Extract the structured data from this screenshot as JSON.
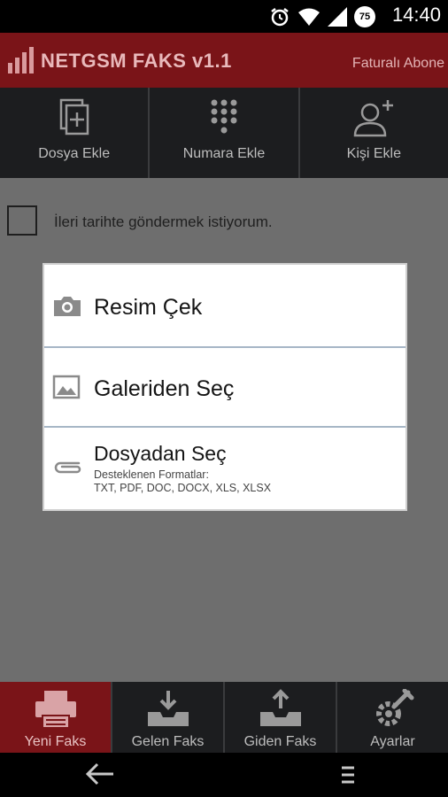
{
  "status_bar": {
    "time": "14:40",
    "battery": "75"
  },
  "app_bar": {
    "title": "NETGSM FAKS v1.1",
    "subtitle": "Faturalı Abone"
  },
  "toolbar": {
    "items": [
      {
        "label": "Dosya Ekle",
        "icon": "document-add-icon"
      },
      {
        "label": "Numara Ekle",
        "icon": "dialpad-icon"
      },
      {
        "label": "Kişi Ekle",
        "icon": "add-person-icon"
      }
    ]
  },
  "schedule": {
    "label": "İleri tarihte göndermek istiyorum.",
    "checked": false
  },
  "dialog": {
    "options": [
      {
        "title": "Resim Çek",
        "icon": "camera-icon"
      },
      {
        "title": "Galeriden Seç",
        "icon": "gallery-icon"
      },
      {
        "title": "Dosyadan Seç",
        "subtitle": "Desteklenen Formatlar:",
        "formats": "TXT, PDF, DOC, DOCX, XLS, XLSX",
        "icon": "paperclip-icon"
      }
    ]
  },
  "tabs": {
    "items": [
      {
        "label": "Yeni Faks",
        "icon": "fax-icon",
        "active": true
      },
      {
        "label": "Gelen Faks",
        "icon": "inbox-download-icon",
        "active": false
      },
      {
        "label": "Giden Faks",
        "icon": "outbox-upload-icon",
        "active": false
      },
      {
        "label": "Ayarlar",
        "icon": "settings-tools-icon",
        "active": false
      }
    ]
  },
  "colors": {
    "brand": "#7a1418",
    "toolbar": "#1c1d1f",
    "overlay": "#6e6e6e",
    "divider": "#a6b6c6"
  }
}
